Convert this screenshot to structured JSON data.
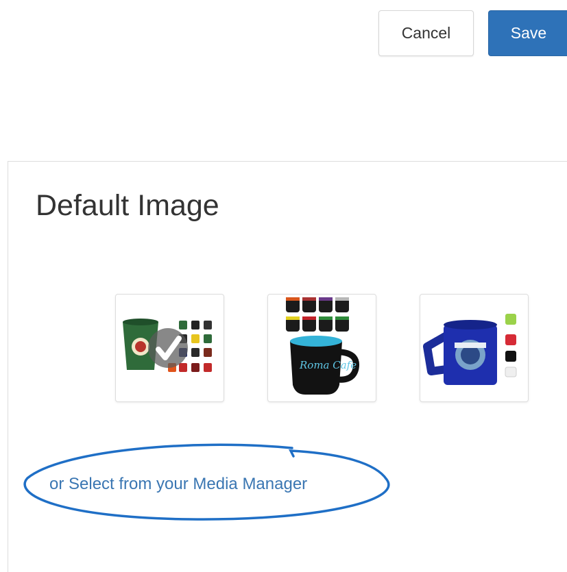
{
  "toolbar": {
    "cancel_label": "Cancel",
    "save_label": "Save",
    "save_color": "#2e72b8"
  },
  "panel": {
    "title": "Default Image",
    "images": [
      {
        "name": "green-mug-thumbnail",
        "selected": true,
        "icon": "check-icon"
      },
      {
        "name": "black-bistro-mug-thumbnail",
        "selected": false
      },
      {
        "name": "blue-mug-thumbnail",
        "selected": false
      }
    ],
    "media_link": "or Select from your Media Manager",
    "link_color": "#3a76b2",
    "annotation_color": "#1f6fc6"
  }
}
